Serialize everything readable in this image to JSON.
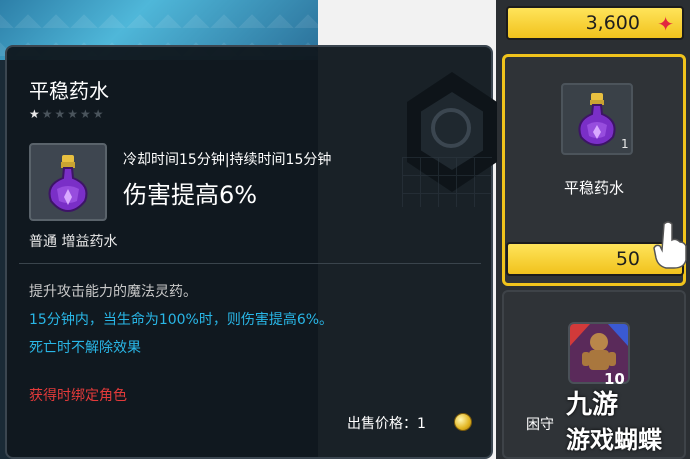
{
  "tooltip": {
    "title": "平稳药水",
    "stars_filled": 1,
    "stars_total": 6,
    "cooldown_text": "冷却时间15分钟|持续时间15分钟",
    "effect_text": "伤害提高6%",
    "category": "普通 增益药水",
    "desc_line1": "提升攻击能力的魔法灵药。",
    "desc_line2": "15分钟内，当生命为100%时，则伤害提高6%。",
    "desc_line3": "死亡时不解除效果",
    "bind_note": "获得时绑定角色",
    "sell_price_label": "出售价格：1"
  },
  "shop": {
    "top_price": "3,600",
    "selected_item": {
      "name": "平稳药水",
      "quantity": "1",
      "price": "50"
    },
    "second_item": {
      "name": "困守",
      "quantity": "10"
    }
  },
  "watermark": {
    "line1": "九游",
    "line2": "游戏蝴蝶"
  },
  "colors": {
    "accent_gold": "#f1c21d",
    "highlight_blue": "#29b6e6",
    "warning_red": "#e23a3a",
    "currency_red": "#e2263f"
  },
  "icons": [
    "potion-icon",
    "star-currency-icon",
    "coin-icon",
    "pointer-hand-icon"
  ]
}
